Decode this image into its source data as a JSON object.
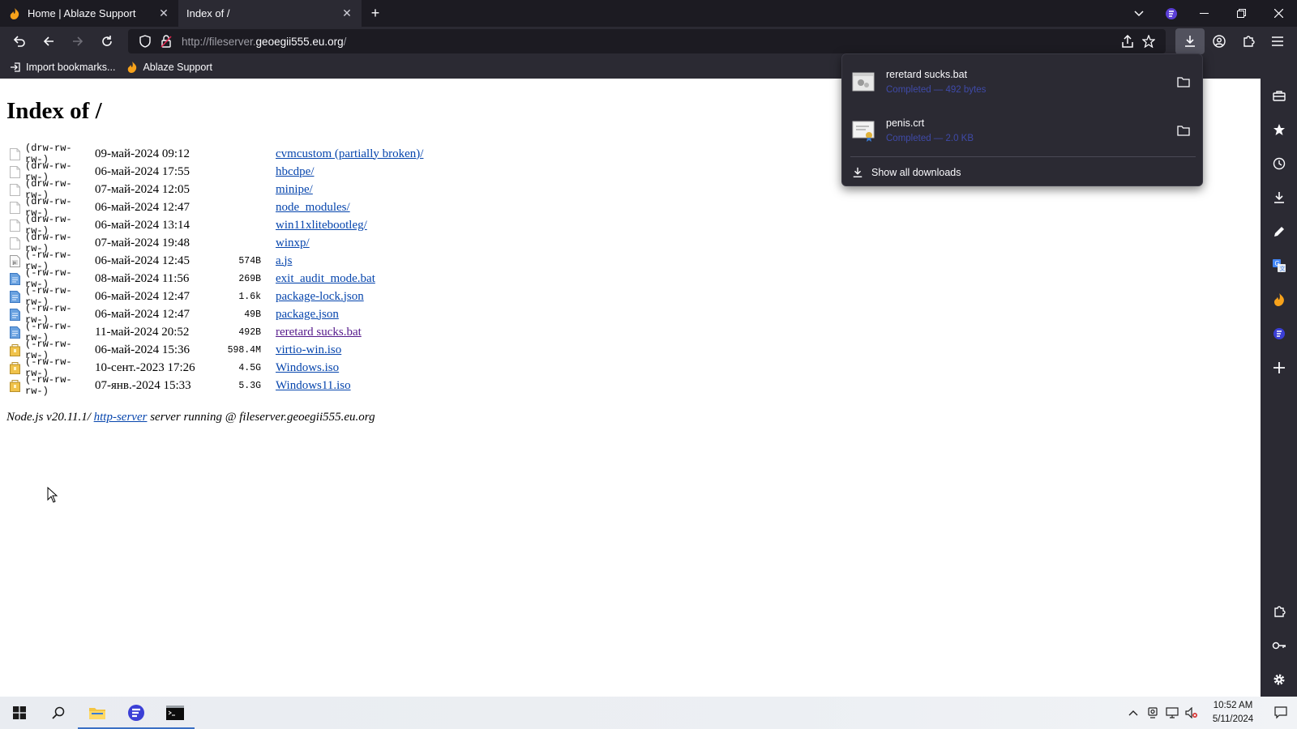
{
  "browser": {
    "tabs": [
      {
        "title": "Home | Ablaze Support",
        "favicon": "ablaze-flame-icon",
        "active": false
      },
      {
        "title": "Index of /",
        "favicon": "",
        "active": true
      }
    ],
    "url_prefix": "http://fileserver.",
    "url_domain": "geoegii555.eu.org",
    "url_suffix": "/",
    "bookmarks": [
      {
        "label": "Import bookmarks...",
        "icon": "import-icon"
      },
      {
        "label": "Ablaze Support",
        "icon": "ablaze-flame-icon"
      }
    ]
  },
  "page": {
    "title": "Index of /",
    "entries": [
      {
        "perm": "(drw-rw-rw-)",
        "date": "09-май-2024 09:12",
        "size": "",
        "name": "cvmcustom (partially broken)/",
        "icon": "folder-blank-icon",
        "visited": false
      },
      {
        "perm": "(drw-rw-rw-)",
        "date": "06-май-2024 17:55",
        "size": "",
        "name": "hbcdpe/",
        "icon": "folder-blank-icon",
        "visited": false
      },
      {
        "perm": "(drw-rw-rw-)",
        "date": "07-май-2024 12:05",
        "size": "",
        "name": "minipe/",
        "icon": "folder-blank-icon",
        "visited": false
      },
      {
        "perm": "(drw-rw-rw-)",
        "date": "06-май-2024 12:47",
        "size": "",
        "name": "node_modules/",
        "icon": "folder-blank-icon",
        "visited": false
      },
      {
        "perm": "(drw-rw-rw-)",
        "date": "06-май-2024 13:14",
        "size": "",
        "name": "win11xlitebootleg/",
        "icon": "folder-blank-icon",
        "visited": false
      },
      {
        "perm": "(drw-rw-rw-)",
        "date": "07-май-2024 19:48",
        "size": "",
        "name": "winxp/",
        "icon": "folder-blank-icon",
        "visited": false
      },
      {
        "perm": "(-rw-rw-rw-)",
        "date": "06-май-2024 12:45",
        "size": "574B",
        "name": "a.js",
        "icon": "js-file-icon",
        "visited": false
      },
      {
        "perm": "(-rw-rw-rw-)",
        "date": "08-май-2024 11:56",
        "size": "269B",
        "name": "exit_audit_mode.bat",
        "icon": "text-file-icon",
        "visited": false
      },
      {
        "perm": "(-rw-rw-rw-)",
        "date": "06-май-2024 12:47",
        "size": "1.6k",
        "name": "package-lock.json",
        "icon": "text-file-icon",
        "visited": false
      },
      {
        "perm": "(-rw-rw-rw-)",
        "date": "06-май-2024 12:47",
        "size": "49B",
        "name": "package.json",
        "icon": "text-file-icon",
        "visited": false
      },
      {
        "perm": "(-rw-rw-rw-)",
        "date": "11-май-2024 20:52",
        "size": "492B",
        "name": "reretard sucks.bat",
        "icon": "text-file-icon",
        "visited": true
      },
      {
        "perm": "(-rw-rw-rw-)",
        "date": "06-май-2024 15:36",
        "size": "598.4M",
        "name": "virtio-win.iso",
        "icon": "package-icon",
        "visited": false
      },
      {
        "perm": "(-rw-rw-rw-)",
        "date": "10-сент.-2023 17:26",
        "size": "4.5G",
        "name": "Windows.iso",
        "icon": "package-icon",
        "visited": false
      },
      {
        "perm": "(-rw-rw-rw-)",
        "date": "07-янв.-2024 15:33",
        "size": "5.3G",
        "name": "Windows11.iso",
        "icon": "package-icon",
        "visited": false
      }
    ],
    "footer_prefix": "Node.js v20.11.1/ ",
    "footer_link": "http-server",
    "footer_suffix": " server running @ fileserver.geoegii555.eu.org"
  },
  "downloads": {
    "items": [
      {
        "name": "reretard sucks.bat",
        "status": "Completed — 492 bytes",
        "icon": "bat-file-icon"
      },
      {
        "name": "penis.crt",
        "status": "Completed — 2.0 KB",
        "icon": "certificate-file-icon"
      }
    ],
    "show_all": "Show all downloads"
  },
  "taskbar": {
    "time": "10:52 AM",
    "date": "5/11/2024"
  },
  "colors": {
    "link": "#0645ad",
    "visited": "#551a8b",
    "browser_dark": "#2b2a33",
    "status_blue": "#3f4aa8"
  }
}
